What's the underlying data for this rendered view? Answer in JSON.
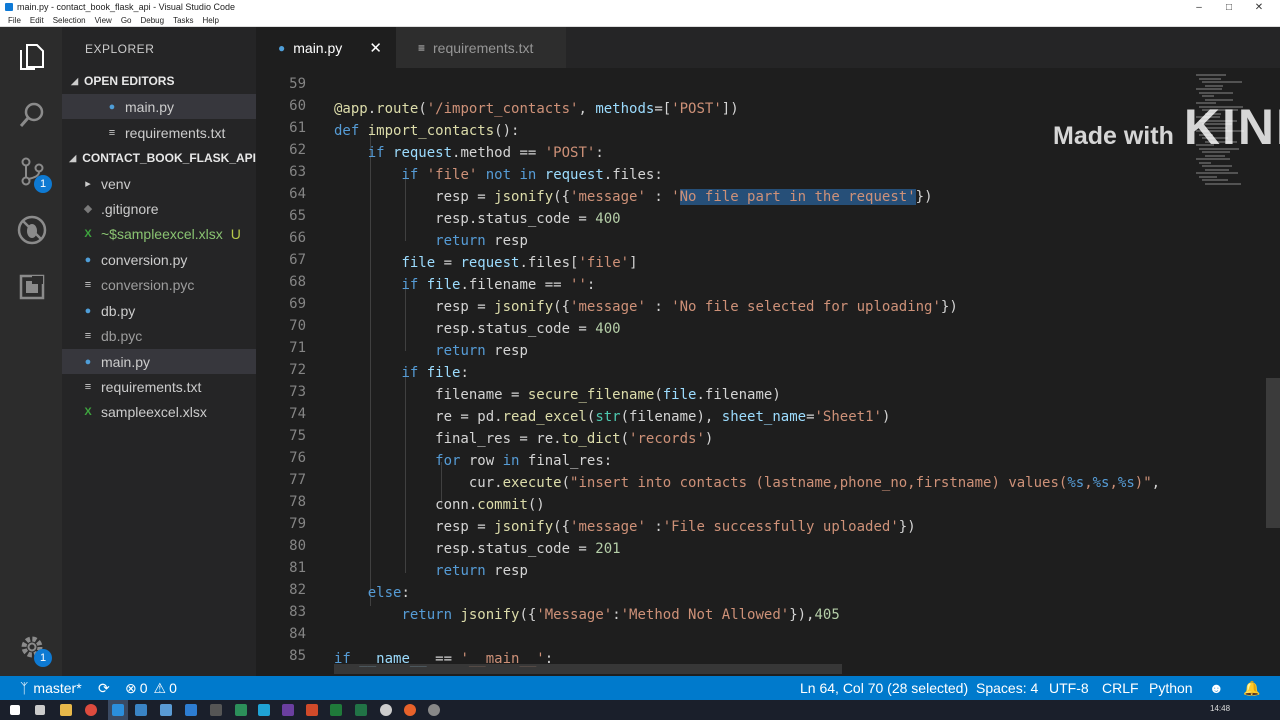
{
  "window": {
    "title": "main.py - contact_book_flask_api - Visual Studio Code",
    "menu": [
      "File",
      "Edit",
      "Selection",
      "View",
      "Go",
      "Debug",
      "Tasks",
      "Help"
    ]
  },
  "activity_bar": {
    "scm_badge": "1",
    "settings_badge": "1"
  },
  "sidebar": {
    "title": "EXPLORER",
    "open_editors_header": "OPEN EDITORS",
    "open_editors": [
      {
        "name": "main.py",
        "icon": "python-icon"
      },
      {
        "name": "requirements.txt",
        "icon": "file-lines-icon"
      }
    ],
    "project_header": "CONTACT_BOOK_FLASK_API",
    "files": [
      {
        "name": "venv",
        "icon": "chevron-right-icon"
      },
      {
        "name": ".gitignore",
        "icon": "git-icon"
      },
      {
        "name": "~$sampleexcel.xlsx",
        "icon": "excel-icon",
        "status": "U"
      },
      {
        "name": "conversion.py",
        "icon": "python-icon"
      },
      {
        "name": "conversion.pyc",
        "icon": "file-lines-icon"
      },
      {
        "name": "db.py",
        "icon": "python-icon"
      },
      {
        "name": "db.pyc",
        "icon": "file-lines-icon"
      },
      {
        "name": "main.py",
        "icon": "python-icon"
      },
      {
        "name": "requirements.txt",
        "icon": "file-lines-icon"
      },
      {
        "name": "sampleexcel.xlsx",
        "icon": "excel-icon"
      }
    ]
  },
  "tabs": [
    {
      "label": "main.py",
      "active": true
    },
    {
      "label": "requirements.txt",
      "active": false
    }
  ],
  "editor": {
    "line_numbers": [
      "59",
      "60",
      "61",
      "62",
      "63",
      "64",
      "65",
      "66",
      "67",
      "68",
      "69",
      "70",
      "71",
      "72",
      "73",
      "74",
      "75",
      "76",
      "77",
      "78",
      "79",
      "80",
      "81",
      "82",
      "83",
      "84",
      "85"
    ],
    "selected_text": "No file part in the request'"
  },
  "watermark": {
    "made_with": "Made with",
    "brand": "KINEMASTER"
  },
  "statusbar": {
    "branch": "master*",
    "errors": "0",
    "warnings": "0",
    "position": "Ln 64, Col 70 (28 selected)",
    "spaces": "Spaces: 4",
    "encoding": "UTF-8",
    "eol": "CRLF",
    "language": "Python"
  },
  "taskbar": {
    "time": "14:48"
  },
  "colors": {
    "accent": "#007acc",
    "editor_bg": "#1e1e1e",
    "sidebar_bg": "#252526",
    "selection": "#264f78"
  }
}
